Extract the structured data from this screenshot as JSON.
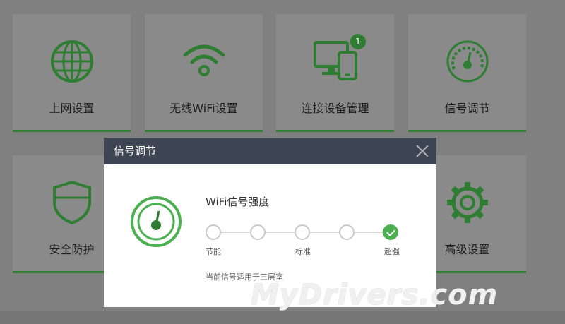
{
  "tiles": [
    {
      "label": "上网设置",
      "icon": "globe-icon"
    },
    {
      "label": "无线WiFi设置",
      "icon": "wifi-icon"
    },
    {
      "label": "连接设备管理",
      "icon": "devices-icon",
      "badge": "1"
    },
    {
      "label": "信号调节",
      "icon": "gauge-icon"
    },
    {
      "label": "安全防护",
      "icon": "shield-icon"
    },
    {
      "label": "高级设置",
      "icon": "gear-icon"
    }
  ],
  "modal": {
    "title": "信号调节",
    "section_title": "WiFi信号强度",
    "levels": [
      "节能",
      "标准",
      "超强"
    ],
    "selected_level": "超强",
    "note": "当前信号适用于三层室"
  },
  "watermark": "MyDrivers.com",
  "colors": {
    "accent": "#4caf50",
    "tile_icon": "#2e7d32",
    "modal_header": "#3e4552"
  }
}
